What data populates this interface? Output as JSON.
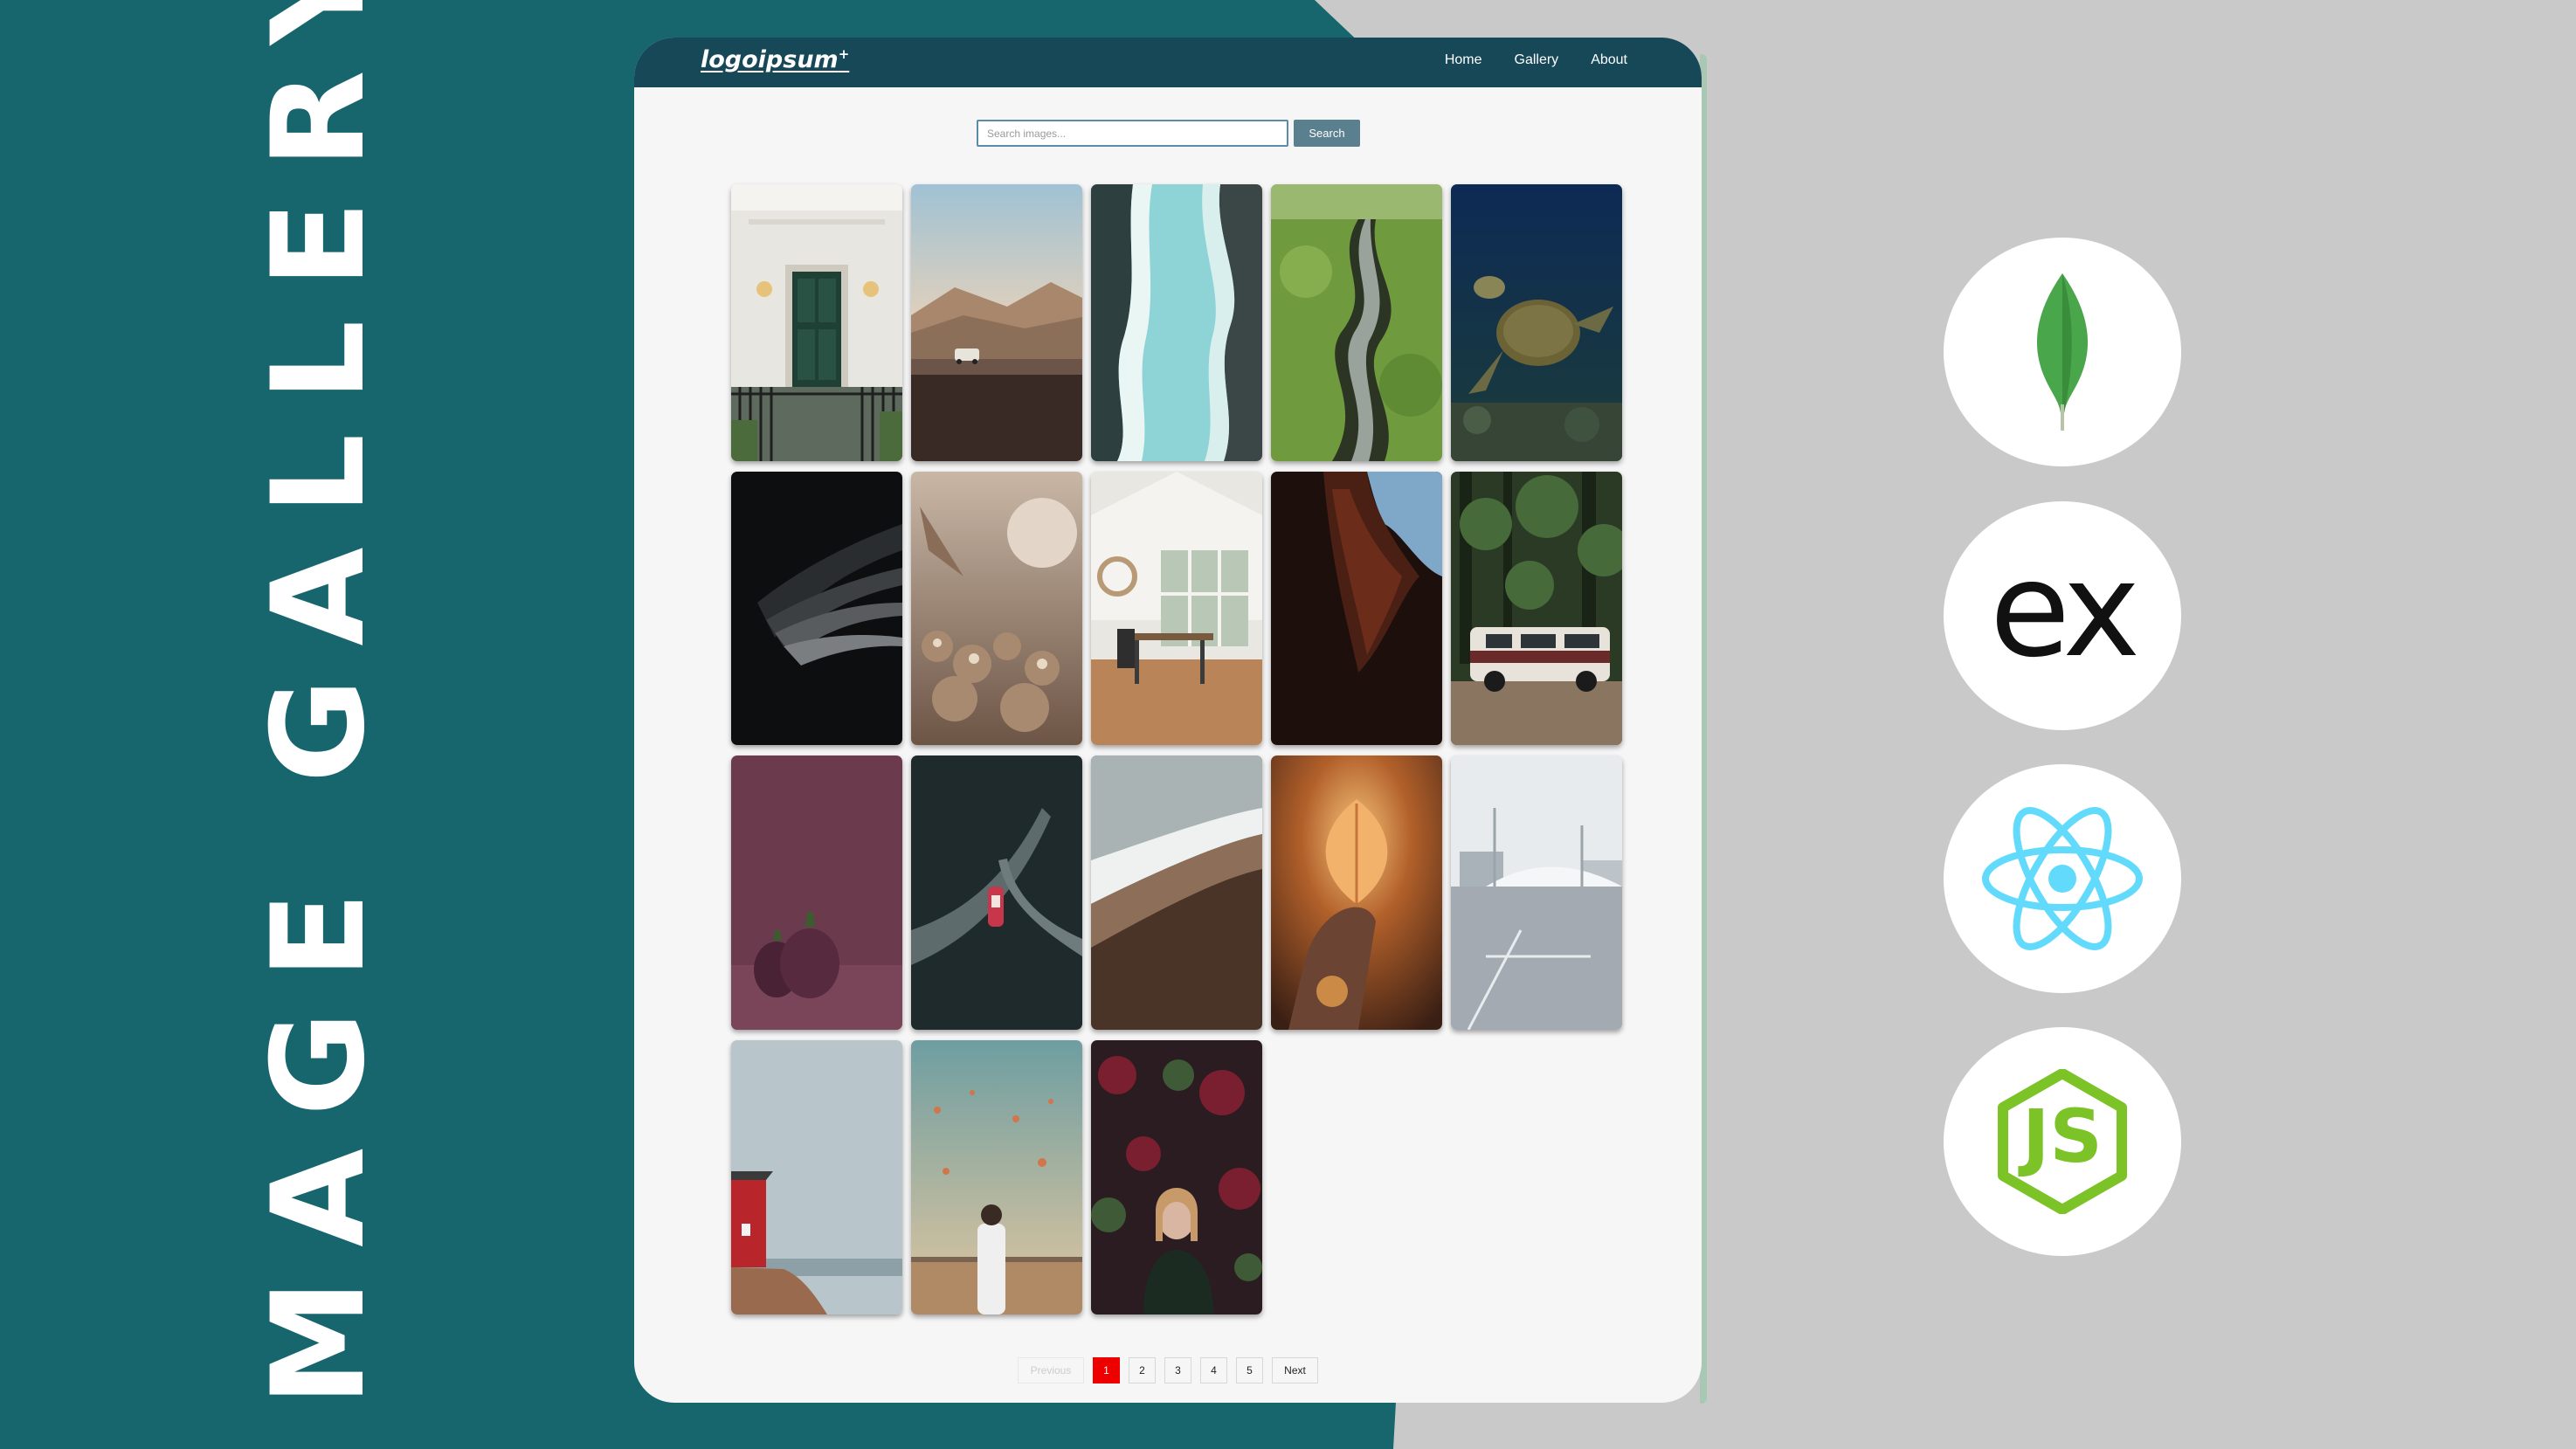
{
  "banner_title": "IMAGE GALLERY",
  "colors": {
    "teal": "#17656d",
    "gray": "#c9c9c9",
    "navbar": "#174858",
    "active_page": "#ee0000"
  },
  "navbar": {
    "logo_text": "logoipsum",
    "logo_mark": "+",
    "links": [
      "Home",
      "Gallery",
      "About"
    ]
  },
  "search": {
    "placeholder": "Search images...",
    "button_label": "Search"
  },
  "gallery": {
    "images": [
      "white house green door",
      "desert road car",
      "aerial ocean coastline",
      "green canyon river",
      "sea turtle underwater",
      "dark abstract waves",
      "dried flowers",
      "dining room interior",
      "red rock canyon",
      "van in forest",
      "purple eggplants",
      "aerial boat ocean",
      "beach waves sand",
      "hand holding leaf at sunset",
      "modern architecture",
      "red house by sea",
      "man with hot air balloons",
      "woman with autumn leaves"
    ]
  },
  "pagination": {
    "previous": "Previous",
    "pages": [
      "1",
      "2",
      "3",
      "4",
      "5"
    ],
    "current_page": "1",
    "next": "Next"
  },
  "tech_badges": [
    "mongodb-icon",
    "express-icon",
    "react-icon",
    "nodejs-icon"
  ],
  "express_text": "ex",
  "node_text": "JS"
}
